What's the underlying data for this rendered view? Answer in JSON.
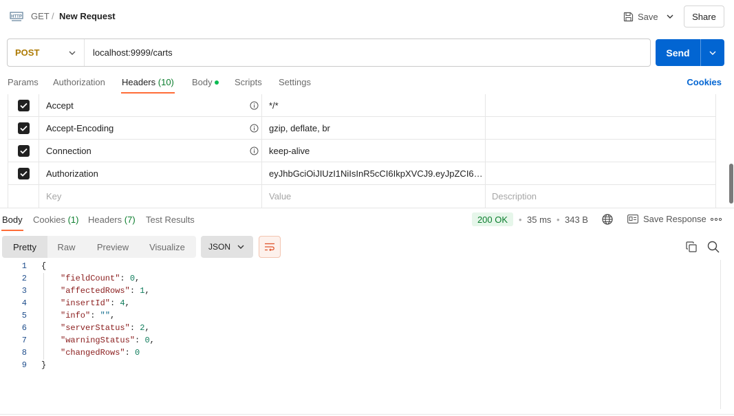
{
  "breadcrumb": {
    "method": "GET",
    "separator": "/",
    "name": "New Request"
  },
  "topbar": {
    "save_label": "Save",
    "share_label": "Share"
  },
  "request": {
    "method": "POST",
    "url": "localhost:9999/carts",
    "send_label": "Send"
  },
  "request_tabs": {
    "params": "Params",
    "authorization": "Authorization",
    "headers": "Headers",
    "headers_count": "(10)",
    "body": "Body",
    "scripts": "Scripts",
    "settings": "Settings",
    "cookies": "Cookies"
  },
  "headers_rows": [
    {
      "key": "Accept",
      "value": "*/*",
      "description": "",
      "checked": true
    },
    {
      "key": "Accept-Encoding",
      "value": "gzip, deflate, br",
      "description": "",
      "checked": true
    },
    {
      "key": "Connection",
      "value": "keep-alive",
      "description": "",
      "checked": true
    },
    {
      "key": "Authorization",
      "value": "eyJhbGciOiJIUzI1NiIsInR5cCI6IkpXVCJ9.eyJpZCI6NC...",
      "description": "",
      "checked": true
    }
  ],
  "headers_placeholder": {
    "key": "Key",
    "value": "Value",
    "description": "Description"
  },
  "response_tabs": {
    "body": "Body",
    "cookies": "Cookies",
    "cookies_count": "(1)",
    "headers": "Headers",
    "headers_count": "(7)",
    "test_results": "Test Results"
  },
  "response_meta": {
    "status": "200 OK",
    "time": "35 ms",
    "size": "343 B",
    "save_response": "Save Response"
  },
  "view_tabs": {
    "pretty": "Pretty",
    "raw": "Raw",
    "preview": "Preview",
    "visualize": "Visualize"
  },
  "format": "JSON",
  "code_lines": [
    {
      "n": "1",
      "text": "{"
    },
    {
      "n": "2",
      "key": "\"fieldCount\"",
      "val": "0",
      "kind": "n",
      "comma": ","
    },
    {
      "n": "3",
      "key": "\"affectedRows\"",
      "val": "1",
      "kind": "n",
      "comma": ","
    },
    {
      "n": "4",
      "key": "\"insertId\"",
      "val": "4",
      "kind": "n",
      "comma": ","
    },
    {
      "n": "5",
      "key": "\"info\"",
      "val": "\"\"",
      "kind": "s",
      "comma": ","
    },
    {
      "n": "6",
      "key": "\"serverStatus\"",
      "val": "2",
      "kind": "n",
      "comma": ","
    },
    {
      "n": "7",
      "key": "\"warningStatus\"",
      "val": "0",
      "kind": "n",
      "comma": ","
    },
    {
      "n": "8",
      "key": "\"changedRows\"",
      "val": "0",
      "kind": "n",
      "comma": ""
    },
    {
      "n": "9",
      "text": "}"
    }
  ],
  "colors": {
    "accent": "#ff6c37",
    "send": "#0265d2",
    "method_post": "#ad7a03",
    "status_ok": "#0a7d2c"
  }
}
